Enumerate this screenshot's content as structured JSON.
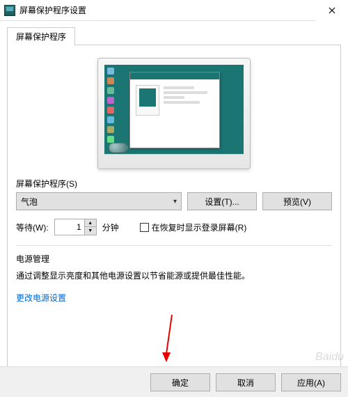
{
  "window": {
    "title": "屏幕保护程序设置"
  },
  "tab": {
    "label": "屏幕保护程序"
  },
  "saver": {
    "group_label": "屏幕保护程序(S)",
    "selected": "气泡",
    "settings_btn": "设置(T)...",
    "preview_btn": "预览(V)"
  },
  "wait": {
    "label": "等待(W):",
    "value": "1",
    "unit": "分钟",
    "resume_checkbox": "在恢复时显示登录屏幕(R)"
  },
  "power": {
    "group_label": "电源管理",
    "description": "通过调整显示亮度和其他电源设置以节省能源或提供最佳性能。",
    "link": "更改电源设置"
  },
  "buttons": {
    "ok": "确定",
    "cancel": "取消",
    "apply": "应用(A)"
  },
  "watermark": "Baidu"
}
